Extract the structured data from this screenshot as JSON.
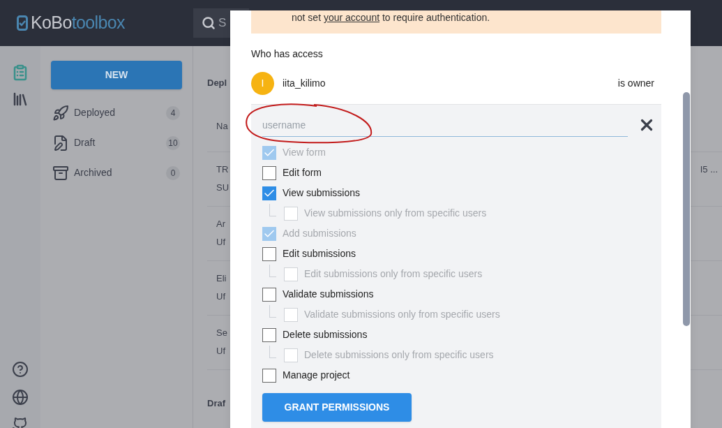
{
  "header": {
    "logo_strong": "KoBo",
    "logo_light": "toolbox",
    "search_placeholder": "S"
  },
  "rail": {
    "items": [
      {
        "selected": true
      },
      {
        "selected": false
      }
    ]
  },
  "sidebar": {
    "new_button": "NEW",
    "items": [
      {
        "label": "Deployed",
        "count": "4"
      },
      {
        "label": "Draft",
        "count": "10"
      },
      {
        "label": "Archived",
        "count": "0"
      }
    ]
  },
  "main": {
    "section_title": "Depl",
    "column_1": "Na",
    "rows": [
      {
        "lines": [
          "TR",
          "SU"
        ],
        "extra": "I5 ..."
      },
      {
        "lines": [
          "Ar",
          "Uf"
        ]
      },
      {
        "lines": [
          "Eli",
          "Uf"
        ]
      },
      {
        "lines": [
          "Se",
          "Uf"
        ]
      }
    ],
    "section_title_2": "Draf"
  },
  "modal": {
    "notice": {
      "before": "not set",
      "link": "your account",
      "after": "to require authentication."
    },
    "access_title": "Who has access",
    "owner": {
      "initial": "I",
      "name": "iita_kilimo",
      "role": "is owner"
    },
    "username": {
      "placeholder": "username"
    },
    "permissions": [
      {
        "kind": "main",
        "label": "View form",
        "checked": true,
        "disabled": true
      },
      {
        "kind": "main",
        "label": "Edit form",
        "checked": false,
        "disabled": false
      },
      {
        "kind": "main",
        "label": "View submissions",
        "checked": true,
        "disabled": false
      },
      {
        "kind": "sub",
        "label": "View submissions only from specific users",
        "checked": false,
        "disabled": true
      },
      {
        "kind": "main",
        "label": "Add submissions",
        "checked": true,
        "disabled": true
      },
      {
        "kind": "main",
        "label": "Edit submissions",
        "checked": false,
        "disabled": false
      },
      {
        "kind": "sub",
        "label": "Edit submissions only from specific users",
        "checked": false,
        "disabled": true
      },
      {
        "kind": "main",
        "label": "Validate submissions",
        "checked": false,
        "disabled": false
      },
      {
        "kind": "sub",
        "label": "Validate submissions only from specific users",
        "checked": false,
        "disabled": true
      },
      {
        "kind": "main",
        "label": "Delete submissions",
        "checked": false,
        "disabled": false
      },
      {
        "kind": "sub",
        "label": "Delete submissions only from specific users",
        "checked": false,
        "disabled": true
      },
      {
        "kind": "main",
        "label": "Manage project",
        "checked": false,
        "disabled": false
      }
    ],
    "grant_button": "GRANT PERMISSIONS"
  }
}
